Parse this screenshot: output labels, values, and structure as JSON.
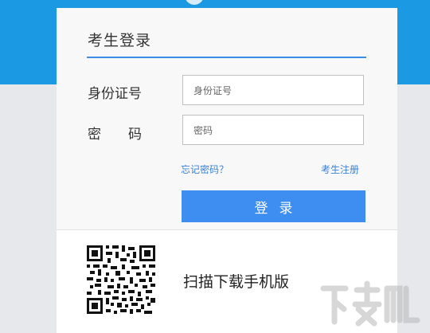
{
  "login": {
    "title": "考生登录",
    "id_label": "身份证号",
    "id_placeholder": "身份证号",
    "password_label": "密　　码",
    "password_placeholder": "密码",
    "forgot_link": "忘记密码？",
    "register_link": "考生注册",
    "submit_label": "登录"
  },
  "mobile": {
    "scan_text": "扫描下载手机版"
  },
  "colors": {
    "banner_blue": "#1b9ae3",
    "accent_blue": "#3d8ef0",
    "link_blue": "#3a80d9"
  }
}
